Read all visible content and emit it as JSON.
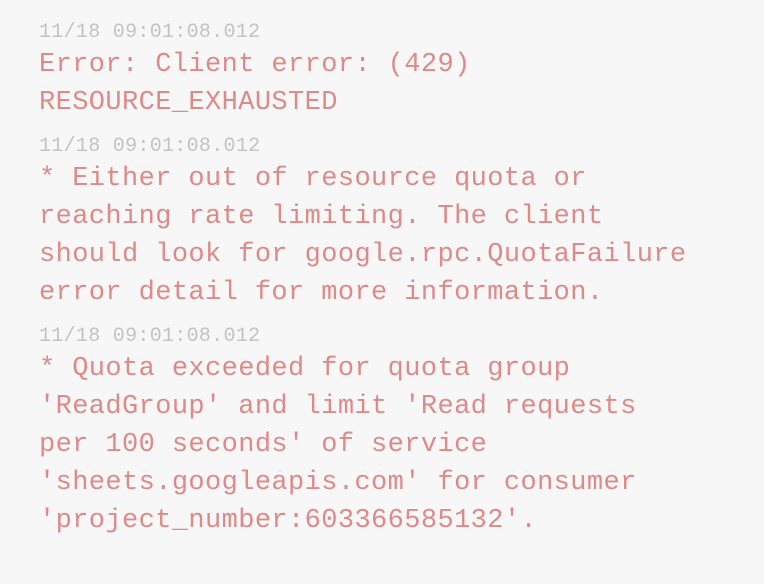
{
  "colors": {
    "background": "#f7f7f7",
    "timestamp": "#c3c3c3",
    "error_text": "#de8a89"
  },
  "log": {
    "entries": [
      {
        "timestamp": "11/18 09:01:08.012",
        "lines": [
          "Error: Client error: (429)",
          "RESOURCE_EXHAUSTED"
        ]
      },
      {
        "timestamp": "11/18 09:01:08.012",
        "lines": [
          "* Either out of resource quota or",
          "reaching rate limiting. The client",
          "should look for google.rpc.QuotaFailure",
          "error detail for more information."
        ]
      },
      {
        "timestamp": "11/18 09:01:08.012",
        "lines": [
          "* Quota exceeded for quota group",
          "'ReadGroup' and limit 'Read requests",
          "per 100 seconds' of service",
          "'sheets.googleapis.com' for consumer",
          "'project_number:603366585132'."
        ]
      }
    ]
  }
}
